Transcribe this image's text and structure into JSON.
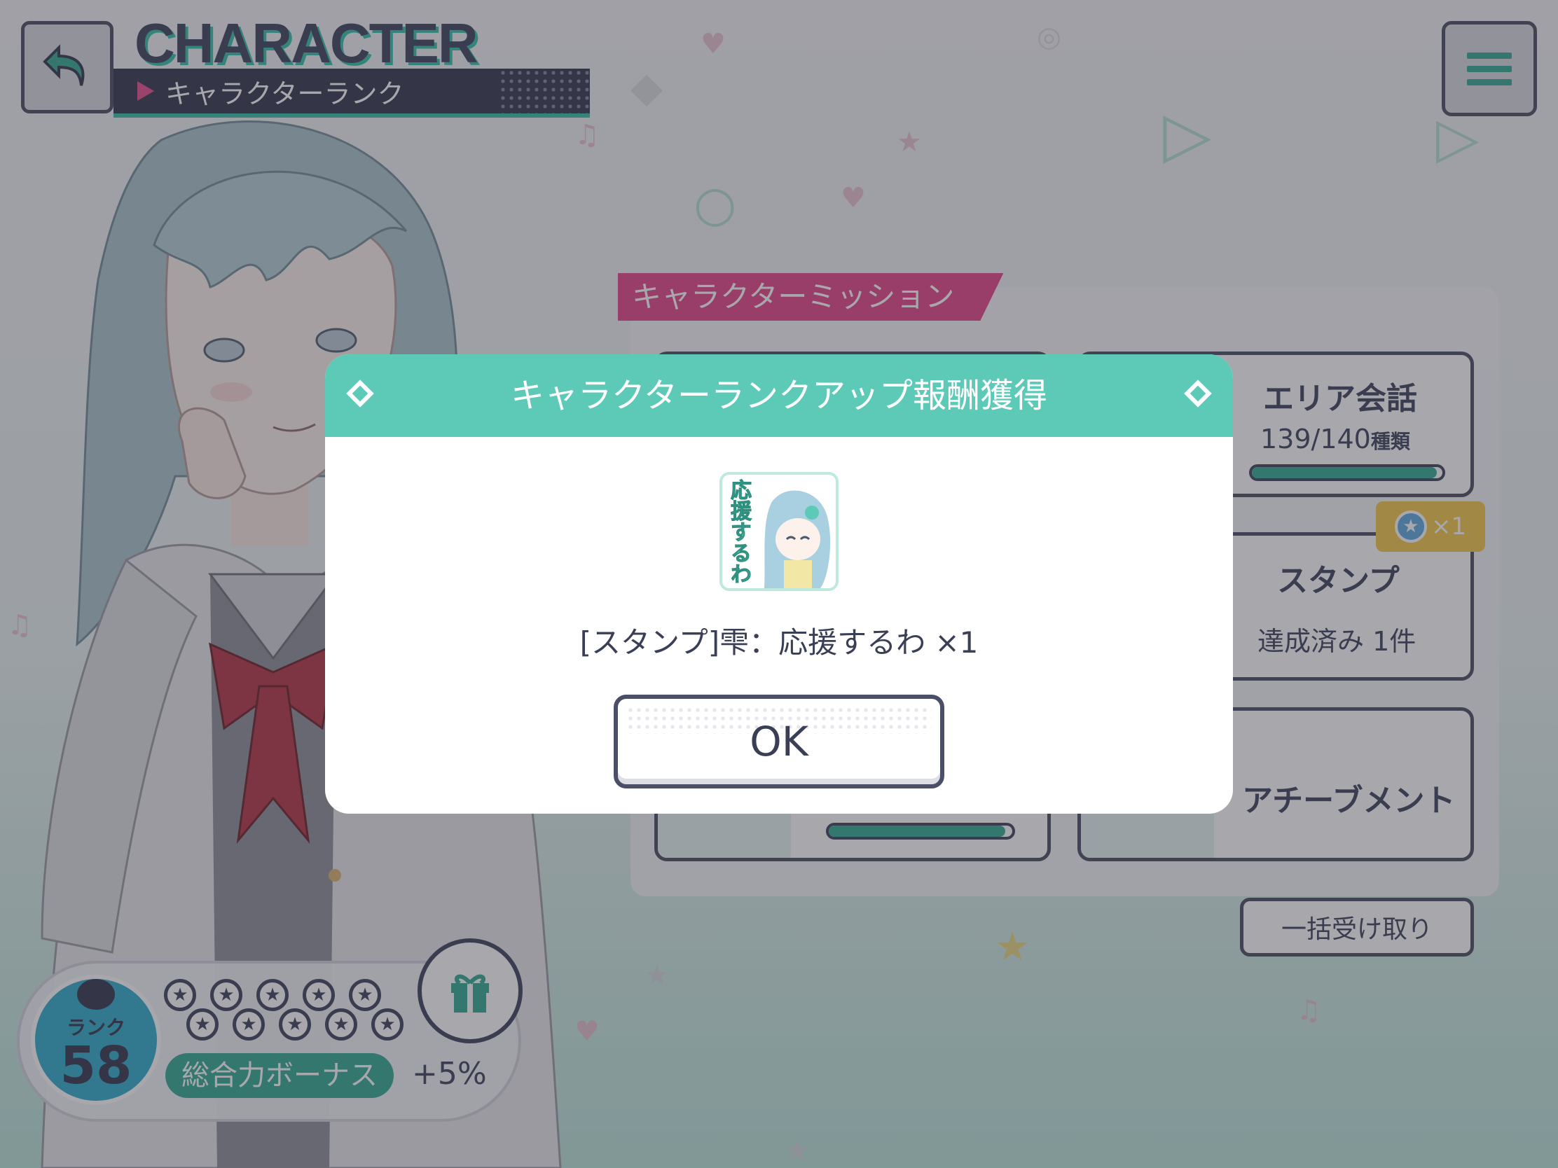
{
  "header": {
    "title": "CHARACTER",
    "subtitle": "キャラクターランク"
  },
  "icons": {
    "back": "back-arrow-icon",
    "menu": "hamburger-menu-icon",
    "gift": "gift-icon"
  },
  "missions": {
    "header": "キャラクターミッション",
    "cards": [
      {
        "title": "エリア会話",
        "sub": "139/140",
        "sub_unit": "種類",
        "progress": 0.99
      },
      {
        "title": "スタンプ",
        "sub": "達成済み 1件"
      },
      {
        "title": "アチーブメント"
      }
    ],
    "badge_text": "×1",
    "bulk_receive": "一括受け取り"
  },
  "rank": {
    "label": "ランク",
    "value": "58",
    "bonus_label": "総合力ボーナス",
    "bonus_value": "+5%"
  },
  "modal": {
    "title": "キャラクターランクアップ報酬獲得",
    "reward_text": "[スタンプ]雫：応援するわ ×1",
    "reward_icon_text": "応援するわ",
    "ok_label": "OK"
  },
  "colors": {
    "accent": "#5ccab7",
    "teal": "#2fa890",
    "pink": "#e53f85",
    "dark": "#3a3f56"
  }
}
